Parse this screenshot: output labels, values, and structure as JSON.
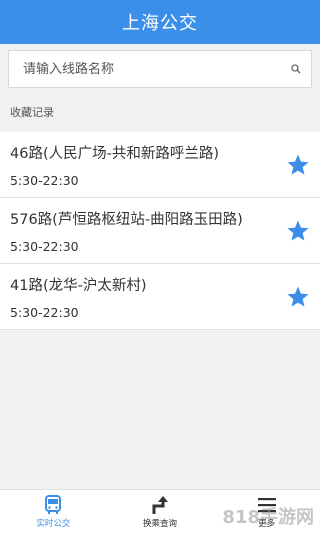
{
  "header": {
    "title": "上海公交"
  },
  "search": {
    "placeholder": "请输入线路名称",
    "value": ""
  },
  "favorites": {
    "section_label": "收藏记录",
    "items": [
      {
        "title": "46路(人民广场-共和新路呼兰路)",
        "hours": "5:30-22:30",
        "starred": true
      },
      {
        "title": "576路(芦恒路枢纽站-曲阳路玉田路)",
        "hours": "5:30-22:30",
        "starred": true
      },
      {
        "title": "41路(龙华-沪太新村)",
        "hours": "5:30-22:30",
        "starred": true
      }
    ]
  },
  "tabbar": {
    "tabs": [
      {
        "label": "实时公交",
        "icon": "bus-icon",
        "active": true
      },
      {
        "label": "换乘查询",
        "icon": "transfer-arrow-icon",
        "active": false
      },
      {
        "label": "更多",
        "icon": "menu-icon",
        "active": false
      }
    ]
  },
  "watermark": {
    "text": "818手游网"
  },
  "colors": {
    "primary": "#3c8fe8",
    "star": "#3c8fe8"
  }
}
